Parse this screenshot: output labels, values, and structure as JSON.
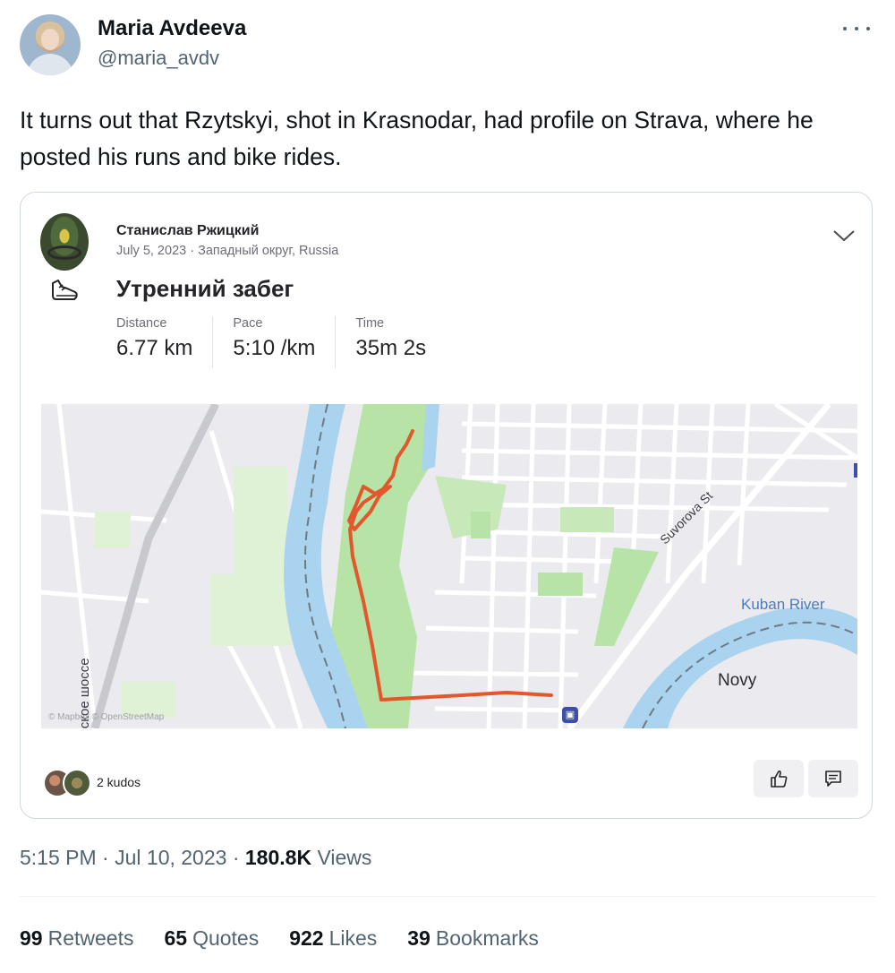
{
  "tweet": {
    "author_name": "Maria Avdeeva",
    "author_handle": "@maria_avdv",
    "text": "It turns out that Rzytskyi, shot in Krasnodar, had profile on Strava, where he posted his runs and bike rides.",
    "time": "5:15 PM",
    "date": "Jul 10, 2023",
    "views_count": "180.8K",
    "views_label": "Views",
    "separator": "·"
  },
  "strava_card": {
    "athlete_name": "Станислав Ржицкий",
    "date": "July 5, 2023",
    "location": "Западный округ, Russia",
    "meta_separator": "·",
    "activity_title": "Утренний забег",
    "activity_icon": "running-shoe-icon",
    "stats": [
      {
        "label": "Distance",
        "value": "6.77 km"
      },
      {
        "label": "Pace",
        "value": "5:10 /km"
      },
      {
        "label": "Time",
        "value": "35m 2s"
      }
    ],
    "map": {
      "labels": {
        "street": "Suvorova St",
        "river": "Kuban River",
        "district": "Novy",
        "highway": "вское шоссе",
        "attribution": "© Mapbox © OpenStreetMap"
      },
      "colors": {
        "route": "#e2572b",
        "water": "#a9d3ef",
        "park": "#b7e3a6",
        "land": "#ebebef"
      }
    },
    "kudos_text": "2 kudos"
  },
  "engagement": [
    {
      "count": "99",
      "label": "Retweets"
    },
    {
      "count": "65",
      "label": "Quotes"
    },
    {
      "count": "922",
      "label": "Likes"
    },
    {
      "count": "39",
      "label": "Bookmarks"
    }
  ]
}
